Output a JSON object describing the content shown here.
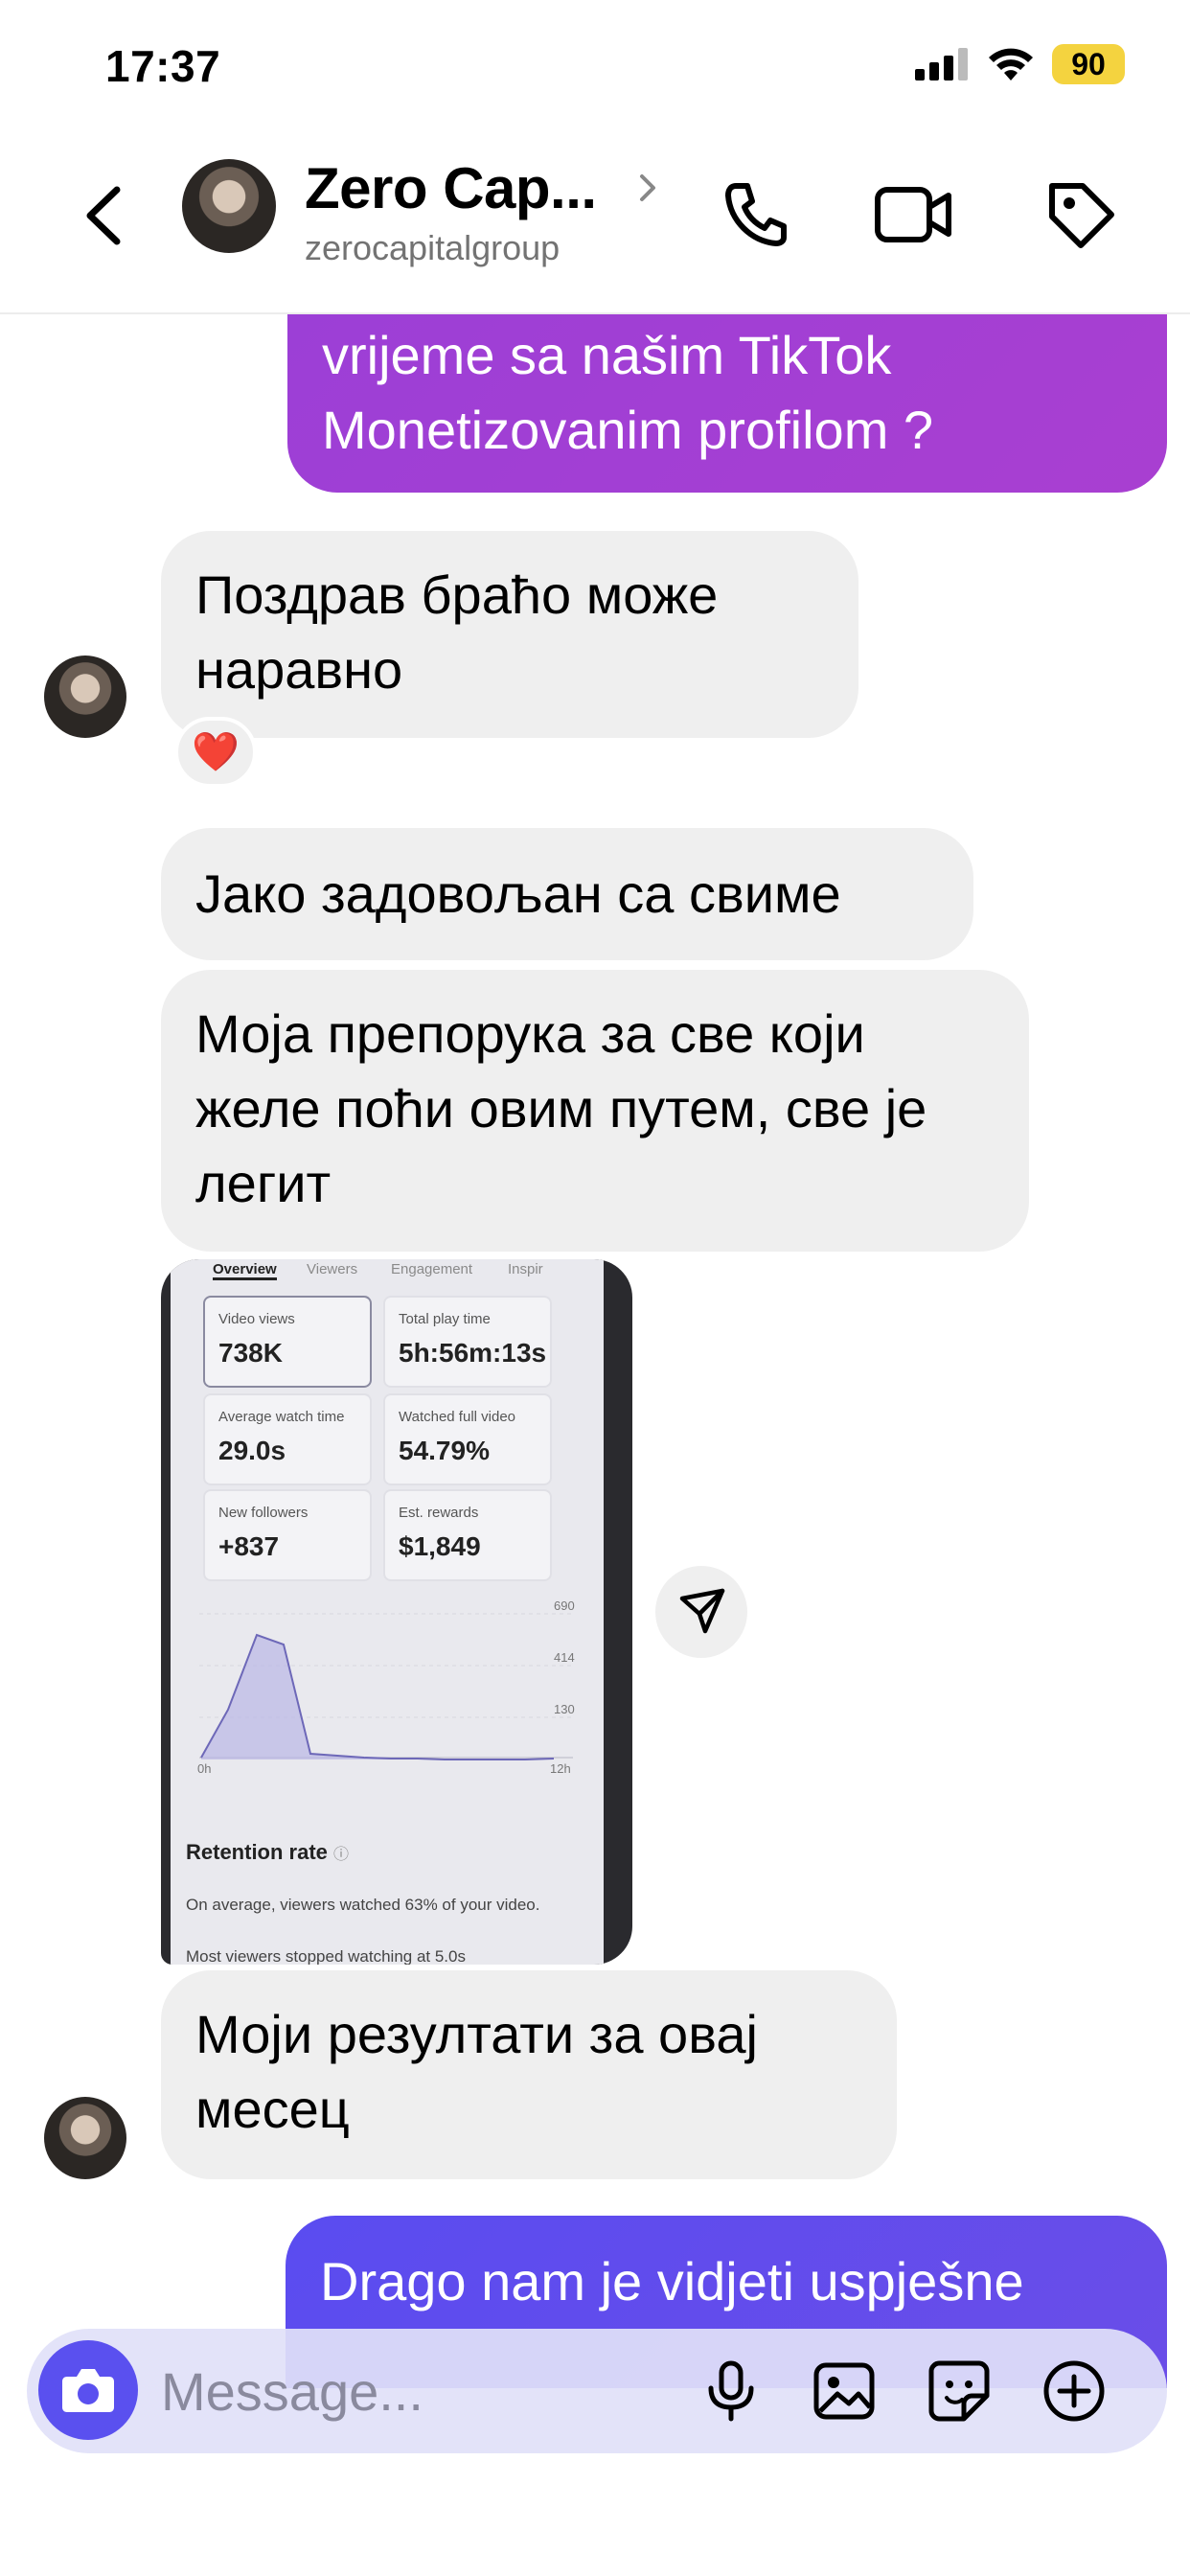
{
  "status_bar": {
    "time": "17:37",
    "battery": "90"
  },
  "header": {
    "name": "Zero Cap...",
    "username": "zerocapitalgroup"
  },
  "messages": {
    "top": "vrijeme sa našim TikTok Monetizovanim profilom ?",
    "pozdrav": "Поздрав браћо може наравно",
    "reaction": "❤️",
    "jako": "Јако задовољан са свиме",
    "moja": "Моја препорука за све који желе поћи овим путем, све је легит",
    "moji": "Моји резултати за овај месец",
    "drago": "Drago nam je vidjeti uspješne"
  },
  "screenshot": {
    "tabs": [
      "Overview",
      "Viewers",
      "Engagement",
      "Inspir"
    ],
    "cards": [
      {
        "label": "Video views",
        "value": "738K"
      },
      {
        "label": "Total play time",
        "value": "5h:56m:13s"
      },
      {
        "label": "Average watch time",
        "value": "29.0s"
      },
      {
        "label": "Watched full video",
        "value": "54.79%"
      },
      {
        "label": "New followers",
        "value": "+837"
      },
      {
        "label": "Est. rewards",
        "value": "$1,849"
      }
    ],
    "chart_ticks": [
      "690",
      "414",
      "130"
    ],
    "x_start": "0h",
    "x_end": "12h",
    "retention_title": "Retention rate",
    "retention_note": "On average, viewers watched 63% of your video.",
    "cut_text": "Most viewers stopped watching at 5.0s"
  },
  "composer": {
    "placeholder": "Message..."
  },
  "colors": {
    "purple": "#a83fd3",
    "blue": "#5a4cf0",
    "incoming": "#efefef"
  }
}
